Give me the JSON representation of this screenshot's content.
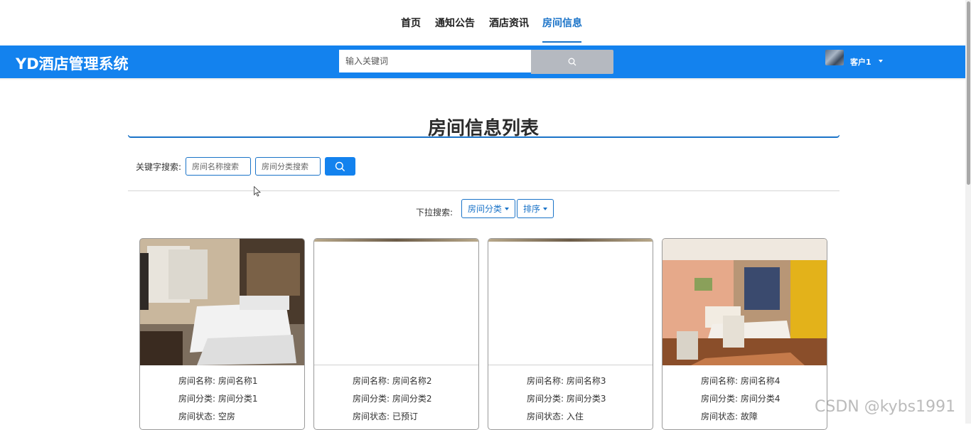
{
  "nav": {
    "items": [
      {
        "label": "首页",
        "active": false
      },
      {
        "label": "通知公告",
        "active": false
      },
      {
        "label": "酒店资讯",
        "active": false
      },
      {
        "label": "房间信息",
        "active": true
      }
    ],
    "accent_color": "#1a73c8"
  },
  "header": {
    "logo": "YD酒店管理系统",
    "search_placeholder": "输入关键词",
    "search_icon": "search-icon",
    "username": "客户1",
    "background_color": "#1382ee"
  },
  "page": {
    "title": "房间信息列表",
    "keyword_label": "关键字搜索:",
    "room_name_placeholder": "房间名称搜索",
    "room_category_placeholder": "房间分类搜索",
    "dropdown_label": "下拉搜索:",
    "category_dropdown": "房间分类",
    "sort_dropdown": "排序"
  },
  "rooms": [
    {
      "name_label": "房间名称: 房间名称1",
      "category_label": "房间分类: 房间分类1",
      "status_label": "房间状态: 空房",
      "image": "hotel-room-photo"
    },
    {
      "name_label": "房间名称: 房间名称2",
      "category_label": "房间分类: 房间分类2",
      "status_label": "房间状态: 已预订",
      "image": "blank"
    },
    {
      "name_label": "房间名称: 房间名称3",
      "category_label": "房间分类: 房间分类3",
      "status_label": "房间状态: 入住",
      "image": "blank"
    },
    {
      "name_label": "房间名称: 房间名称4",
      "category_label": "房间分类: 房间分类4",
      "status_label": "房间状态: 故障",
      "image": "hotel-room-photo"
    }
  ],
  "watermark": "CSDN @kybs1991"
}
